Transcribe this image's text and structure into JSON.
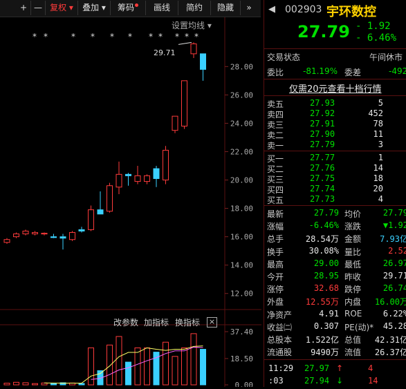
{
  "toolbar": {
    "plus": "+",
    "minus": "—",
    "fuquan": "复权",
    "diejia": "叠加",
    "chouma": "筹码",
    "huaxian": "画线",
    "jianyue": "简约",
    "yincang": "隐藏",
    "more": "»"
  },
  "chart": {
    "settings_label": "设置均线",
    "marks": "* * * * * * * * * * *",
    "max_label": "29.71",
    "y_ticks": [
      "28.00",
      "26.00",
      "24.00",
      "22.00",
      "20.00",
      "18.00",
      "16.00",
      "14.00",
      "12.00"
    ],
    "ind_tabs": {
      "gai": "改参数",
      "add": "加指标",
      "swap": "换指标",
      "close": "×"
    },
    "vol_ticks": [
      "37.40",
      "18.50",
      "0.00"
    ]
  },
  "chart_data": {
    "type": "candlestick",
    "ylim": [
      11.5,
      30.5
    ],
    "candles": [
      {
        "o": 15.6,
        "h": 15.9,
        "l": 15.5,
        "c": 15.8,
        "up": true
      },
      {
        "o": 16.0,
        "h": 16.3,
        "l": 15.9,
        "c": 16.2,
        "up": true
      },
      {
        "o": 16.2,
        "h": 16.5,
        "l": 16.1,
        "c": 16.4,
        "up": true
      },
      {
        "o": 16.2,
        "h": 16.4,
        "l": 16.1,
        "c": 16.3,
        "up": true
      },
      {
        "o": 16.2,
        "h": 16.3,
        "l": 16.1,
        "c": 16.25,
        "up": true
      },
      {
        "o": 16.0,
        "h": 16.2,
        "l": 15.9,
        "c": 15.95,
        "up": false
      },
      {
        "o": 16.0,
        "h": 16.2,
        "l": 15.1,
        "c": 15.9,
        "up": false
      },
      {
        "o": 15.8,
        "h": 16.4,
        "l": 15.7,
        "c": 16.3,
        "up": true
      },
      {
        "o": 16.4,
        "h": 16.7,
        "l": 16.3,
        "c": 16.5,
        "up": false
      },
      {
        "o": 16.5,
        "h": 18.2,
        "l": 16.4,
        "c": 17.9,
        "up": true
      },
      {
        "o": 17.9,
        "h": 19.2,
        "l": 17.6,
        "c": 17.6,
        "up": false
      },
      {
        "o": 17.8,
        "h": 19.8,
        "l": 17.7,
        "c": 19.6,
        "up": true
      },
      {
        "o": 19.5,
        "h": 21.3,
        "l": 19.0,
        "c": 20.4,
        "up": true
      },
      {
        "o": 20.4,
        "h": 20.5,
        "l": 19.6,
        "c": 20.3,
        "up": false
      },
      {
        "o": 19.9,
        "h": 21.0,
        "l": 19.7,
        "c": 20.3,
        "up": true
      },
      {
        "o": 19.9,
        "h": 20.4,
        "l": 19.7,
        "c": 20.3,
        "up": true
      },
      {
        "o": 20.1,
        "h": 21.0,
        "l": 19.5,
        "c": 20.8,
        "up": false
      },
      {
        "o": 20.0,
        "h": 22.4,
        "l": 19.7,
        "c": 22.1,
        "up": true
      },
      {
        "o": 23.5,
        "h": 24.5,
        "l": 23.3,
        "c": 24.5,
        "up": true
      },
      {
        "o": 23.8,
        "h": 27.0,
        "l": 23.6,
        "c": 27.0,
        "up": true
      },
      {
        "o": 28.9,
        "h": 29.7,
        "l": 28.6,
        "c": 29.6,
        "up": true
      },
      {
        "o": 28.9,
        "h": 28.9,
        "l": 27.0,
        "c": 27.8,
        "up": false
      }
    ],
    "volumes": [
      1.2,
      1.8,
      1.5,
      0.9,
      1.3,
      1.0,
      1.5,
      1.3,
      1.0,
      26,
      10,
      28,
      34,
      16,
      26,
      26,
      23,
      30,
      20,
      26,
      36,
      25
    ],
    "vol_ylim": [
      0,
      37.4
    ]
  },
  "panel": {
    "code": "002903",
    "name": "宇环数控",
    "price": "27.79",
    "change": "- 1.92",
    "change_pct": "- 6.46%",
    "status_label": "交易状态",
    "status_value": "午间休市",
    "weibi_label": "委比",
    "weibi_value": "-81.19%",
    "weicha_label": "委差",
    "weicha_value": "-492",
    "promo": "仅需20元查看十档行情",
    "asks": [
      {
        "label": "卖五",
        "price": "27.93",
        "vol": "5"
      },
      {
        "label": "卖四",
        "price": "27.92",
        "vol": "452"
      },
      {
        "label": "卖三",
        "price": "27.91",
        "vol": "78"
      },
      {
        "label": "卖二",
        "price": "27.90",
        "vol": "11"
      },
      {
        "label": "卖一",
        "price": "27.79",
        "vol": "3"
      }
    ],
    "bids": [
      {
        "label": "买一",
        "price": "27.77",
        "vol": "1"
      },
      {
        "label": "买二",
        "price": "27.76",
        "vol": "14"
      },
      {
        "label": "买三",
        "price": "27.75",
        "vol": "18"
      },
      {
        "label": "买四",
        "price": "27.74",
        "vol": "20"
      },
      {
        "label": "买五",
        "price": "27.73",
        "vol": "4"
      }
    ],
    "stats": [
      {
        "l1": "最新",
        "v1": "27.79",
        "c1": "green",
        "l2": "均价",
        "v2": "27.79",
        "c2": "green"
      },
      {
        "l1": "涨幅",
        "v1": "-6.46%",
        "c1": "green",
        "l2": "涨跌",
        "v2": "▼1.92",
        "c2": "green"
      },
      {
        "l1": "总手",
        "v1": "28.54万",
        "c1": "white",
        "l2": "金额",
        "v2": "7.93亿",
        "c2": "cyan"
      },
      {
        "l1": "换手",
        "v1": "30.08%",
        "c1": "white",
        "l2": "量比",
        "v2": "2.52",
        "c2": "red"
      },
      {
        "l1": "最高",
        "v1": "29.00",
        "c1": "green",
        "l2": "最低",
        "v2": "26.97",
        "c2": "green"
      },
      {
        "l1": "今开",
        "v1": "28.95",
        "c1": "green",
        "l2": "昨收",
        "v2": "29.71",
        "c2": "white"
      },
      {
        "l1": "涨停",
        "v1": "32.68",
        "c1": "red",
        "l2": "跌停",
        "v2": "26.74",
        "c2": "green"
      },
      {
        "l1": "外盘",
        "v1": "12.55万",
        "c1": "red",
        "l2": "内盘",
        "v2": "16.00万",
        "c2": "green"
      },
      {
        "l1": "净资产",
        "v1": "4.91",
        "c1": "white",
        "l2": "ROE",
        "v2": "6.22%",
        "c2": "white"
      },
      {
        "l1": "收益㈡",
        "v1": "0.307",
        "c1": "white",
        "l2": "PE(动)*",
        "v2": "45.28",
        "c2": "white"
      },
      {
        "l1": "总股本",
        "v1": "1.522亿",
        "c1": "white",
        "l2": "总值",
        "v2": "42.31亿",
        "c2": "white"
      },
      {
        "l1": "流通股",
        "v1": "9490万",
        "c1": "white",
        "l2": "流值",
        "v2": "26.37亿",
        "c2": "white"
      }
    ],
    "ticks": [
      {
        "time": "11:29",
        "price": "27.97",
        "vol": "4",
        "side": "↑"
      },
      {
        "time": ":03",
        "price": "27.94",
        "vol": "14",
        "side": "↓"
      }
    ]
  }
}
